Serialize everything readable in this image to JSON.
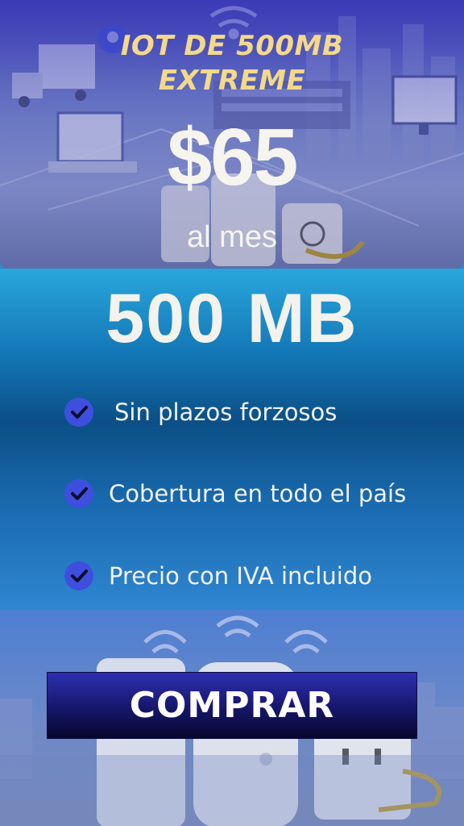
{
  "plan": {
    "title_line1": "IOT DE 500MB",
    "title_line2": "EXTREME",
    "price": "$65",
    "period": "al mes",
    "data_amount": "500 MB"
  },
  "features": [
    {
      "label": "Sin plazos forzosos",
      "icon": "check-icon"
    },
    {
      "label": "Cobertura en todo el país",
      "icon": "check-icon"
    },
    {
      "label": "Precio con IVA incluido",
      "icon": "check-icon"
    }
  ],
  "cta": {
    "label": "COMPRAR"
  },
  "colors": {
    "title_gold": "#f3d98a",
    "check_blue": "#3e4fe0",
    "button_navy": "#16166a"
  }
}
